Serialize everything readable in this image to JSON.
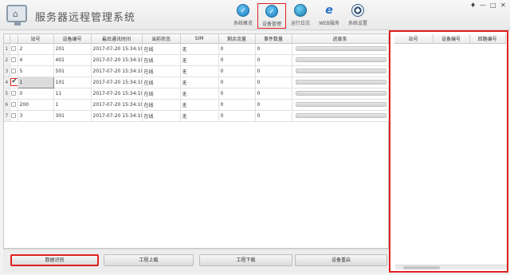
{
  "app": {
    "title": "服务器远程管理系统"
  },
  "window_controls": {
    "pin": "♦",
    "minimize": "—",
    "restore": "□",
    "close": "✕"
  },
  "nav": [
    {
      "label": "系统概览",
      "icon": "check-circle-icon",
      "glyph": "✓"
    },
    {
      "label": "设备管理",
      "icon": "check-circle-icon",
      "glyph": "✓",
      "active": true
    },
    {
      "label": "运行日志",
      "icon": "globe-server-icon",
      "glyph": ""
    },
    {
      "label": "WEB服务",
      "icon": "ie-browser-icon",
      "glyph": "e"
    },
    {
      "label": "系统设置",
      "icon": "eye-settings-icon",
      "glyph": ""
    }
  ],
  "table": {
    "columns": [
      "",
      "",
      "站号",
      "设备编号",
      "最后通讯时间",
      "当前状态",
      "SIM",
      "剩余流量",
      "事件数量",
      "进度条"
    ],
    "rows": [
      {
        "idx": "1",
        "station": "2",
        "device": "201",
        "time": "2017-07-20 15:34:10",
        "status": "在线",
        "sim": "无",
        "traffic": "0",
        "events": "0",
        "progress": 0
      },
      {
        "idx": "2",
        "station": "4",
        "device": "401",
        "time": "2017-07-20 15:34:10",
        "status": "在线",
        "sim": "无",
        "traffic": "0",
        "events": "0",
        "progress": 0
      },
      {
        "idx": "3",
        "station": "5",
        "device": "501",
        "time": "2017-07-20 15:34:10",
        "status": "在线",
        "sim": "无",
        "traffic": "0",
        "events": "0",
        "progress": 0
      },
      {
        "idx": "4",
        "station": "1",
        "device": "101",
        "time": "2017-07-20 15:34:10",
        "status": "在线",
        "sim": "无",
        "traffic": "0",
        "events": "0",
        "progress": 0,
        "checked": true
      },
      {
        "idx": "5",
        "station": "0",
        "device": "11",
        "time": "2017-07-20 15:34:10",
        "status": "在线",
        "sim": "无",
        "traffic": "0",
        "events": "0",
        "progress": 0
      },
      {
        "idx": "6",
        "station": "200",
        "device": "1",
        "time": "2017-07-20 15:34:10",
        "status": "在线",
        "sim": "无",
        "traffic": "0",
        "events": "0",
        "progress": 0
      },
      {
        "idx": "7",
        "station": "3",
        "device": "301",
        "time": "2017-07-20 15:34:10",
        "status": "在线",
        "sim": "无",
        "traffic": "0",
        "events": "0",
        "progress": 0
      }
    ]
  },
  "side_table": {
    "columns": [
      "站号",
      "设备编号",
      "回路编号"
    ]
  },
  "buttons": [
    {
      "label": "数据识别",
      "active": true
    },
    {
      "label": "工程上载"
    },
    {
      "label": "工程下载"
    },
    {
      "label": "设备重启"
    }
  ],
  "colors": {
    "highlight": "#e02020",
    "accent": "#1b7fc0"
  }
}
